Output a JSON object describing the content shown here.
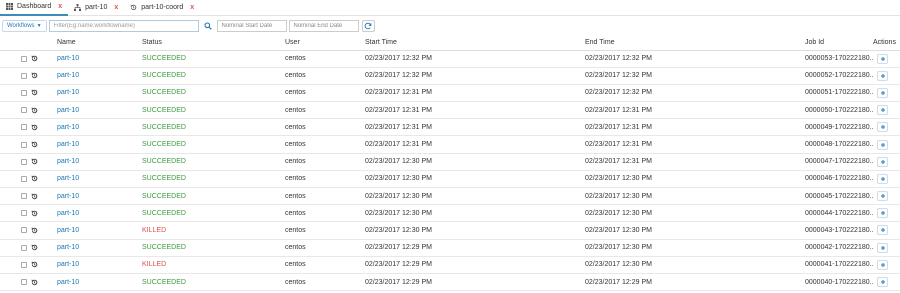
{
  "tabs": [
    {
      "label": "Dashboard",
      "icon": "grid-icon",
      "close": "x"
    },
    {
      "label": "part-10",
      "icon": "workflow-icon",
      "close": "x"
    },
    {
      "label": "part-10-coord",
      "icon": "history-icon",
      "close": "x"
    }
  ],
  "toolbar": {
    "workflows_label": "Workflows",
    "filter_placeholder": "Filter(Eg:name:workflowname)",
    "start_placeholder": "Nominal Start Date",
    "end_placeholder": "Nominal End Date"
  },
  "columns": {
    "name": "Name",
    "status": "Status",
    "user": "User",
    "start": "Start Time",
    "end": "End Time",
    "job": "Job Id",
    "actions": "Actions"
  },
  "rows": [
    {
      "name": "part-10",
      "status": "SUCCEEDED",
      "user": "centos",
      "start": "02/23/2017 12:32 PM",
      "end": "02/23/2017 12:32 PM",
      "job": "0000053-170222180..."
    },
    {
      "name": "part-10",
      "status": "SUCCEEDED",
      "user": "centos",
      "start": "02/23/2017 12:32 PM",
      "end": "02/23/2017 12:32 PM",
      "job": "0000052-170222180..."
    },
    {
      "name": "part-10",
      "status": "SUCCEEDED",
      "user": "centos",
      "start": "02/23/2017 12:31 PM",
      "end": "02/23/2017 12:32 PM",
      "job": "0000051-170222180..."
    },
    {
      "name": "part-10",
      "status": "SUCCEEDED",
      "user": "centos",
      "start": "02/23/2017 12:31 PM",
      "end": "02/23/2017 12:31 PM",
      "job": "0000050-170222180..."
    },
    {
      "name": "part-10",
      "status": "SUCCEEDED",
      "user": "centos",
      "start": "02/23/2017 12:31 PM",
      "end": "02/23/2017 12:31 PM",
      "job": "0000049-170222180..."
    },
    {
      "name": "part-10",
      "status": "SUCCEEDED",
      "user": "centos",
      "start": "02/23/2017 12:31 PM",
      "end": "02/23/2017 12:31 PM",
      "job": "0000048-170222180..."
    },
    {
      "name": "part-10",
      "status": "SUCCEEDED",
      "user": "centos",
      "start": "02/23/2017 12:30 PM",
      "end": "02/23/2017 12:31 PM",
      "job": "0000047-170222180..."
    },
    {
      "name": "part-10",
      "status": "SUCCEEDED",
      "user": "centos",
      "start": "02/23/2017 12:30 PM",
      "end": "02/23/2017 12:30 PM",
      "job": "0000046-170222180..."
    },
    {
      "name": "part-10",
      "status": "SUCCEEDED",
      "user": "centos",
      "start": "02/23/2017 12:30 PM",
      "end": "02/23/2017 12:30 PM",
      "job": "0000045-170222180..."
    },
    {
      "name": "part-10",
      "status": "SUCCEEDED",
      "user": "centos",
      "start": "02/23/2017 12:30 PM",
      "end": "02/23/2017 12:30 PM",
      "job": "0000044-170222180..."
    },
    {
      "name": "part-10",
      "status": "KILLED",
      "user": "centos",
      "start": "02/23/2017 12:30 PM",
      "end": "02/23/2017 12:30 PM",
      "job": "0000043-170222180..."
    },
    {
      "name": "part-10",
      "status": "SUCCEEDED",
      "user": "centos",
      "start": "02/23/2017 12:29 PM",
      "end": "02/23/2017 12:30 PM",
      "job": "0000042-170222180..."
    },
    {
      "name": "part-10",
      "status": "KILLED",
      "user": "centos",
      "start": "02/23/2017 12:29 PM",
      "end": "02/23/2017 12:30 PM",
      "job": "0000041-170222180..."
    },
    {
      "name": "part-10",
      "status": "SUCCEEDED",
      "user": "centos",
      "start": "02/23/2017 12:29 PM",
      "end": "02/23/2017 12:29 PM",
      "job": "0000040-170222180..."
    }
  ],
  "colors": {
    "link": "#1f77b4",
    "succeeded": "#3c9a3c",
    "killed": "#d9534f",
    "tab_close": "#d9534f"
  }
}
